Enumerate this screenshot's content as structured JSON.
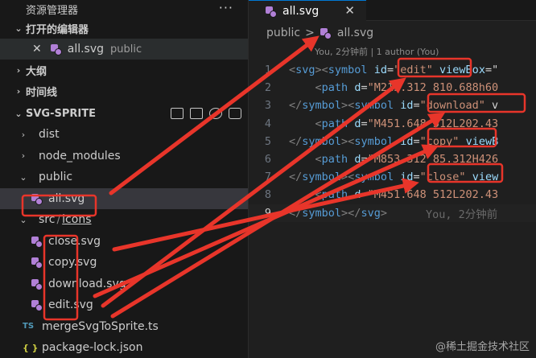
{
  "sidebar": {
    "header_title": "资源管理器",
    "header_more": "···",
    "open_editors": {
      "title": "打开的编辑器",
      "items": [
        {
          "close": "✕",
          "name": "all.svg",
          "path": "public"
        }
      ]
    },
    "outline_title": "大纲",
    "timeline_title": "时间线",
    "project": {
      "title": "SVG-SPRITE",
      "tree": [
        {
          "label": "dist",
          "kind": "folder",
          "open": false
        },
        {
          "label": "node_modules",
          "kind": "folder",
          "open": false
        },
        {
          "label": "public",
          "kind": "folder",
          "open": true
        },
        {
          "label": "all.svg",
          "kind": "svg",
          "depth": 1
        },
        {
          "label": "src",
          "label2": "icons",
          "kind": "folder",
          "open": true
        },
        {
          "label": "close.svg",
          "kind": "svg",
          "depth": 1
        },
        {
          "label": "copy.svg",
          "kind": "svg",
          "depth": 1
        },
        {
          "label": "download.svg",
          "kind": "svg",
          "depth": 1
        },
        {
          "label": "edit.svg",
          "kind": "svg",
          "depth": 1
        },
        {
          "label": "mergeSvgToSprite.ts",
          "kind": "ts",
          "badge": "TS"
        },
        {
          "label": "package-lock.json",
          "kind": "json",
          "badge": "{ }"
        }
      ]
    }
  },
  "editor": {
    "tab": {
      "name": "all.svg",
      "close": "✕"
    },
    "breadcrumb": {
      "folder": "public",
      "sep": ">",
      "file": "all.svg"
    },
    "blame": "You, 2分钟前 | 1 author (You)",
    "lines": [
      {
        "n": "1",
        "parts": [
          [
            "pn",
            "<"
          ],
          [
            "tg",
            "svg"
          ],
          [
            "pn",
            "><"
          ],
          [
            "tg",
            "symbol"
          ],
          [
            "cc",
            " "
          ],
          [
            "ar",
            "id"
          ],
          [
            "cc",
            "="
          ],
          [
            "st",
            "\"edit\""
          ],
          [
            "cc",
            " "
          ],
          [
            "ar",
            "viewBox"
          ],
          [
            "cc",
            "=\""
          ]
        ]
      },
      {
        "n": "2",
        "parts": [
          [
            "cc",
            "    "
          ],
          [
            "pn",
            "<"
          ],
          [
            "tg",
            "path"
          ],
          [
            "cc",
            " "
          ],
          [
            "ar",
            "d"
          ],
          [
            "cc",
            "="
          ],
          [
            "st",
            "\"M213.312 810.688h60"
          ]
        ]
      },
      {
        "n": "3",
        "parts": [
          [
            "pn",
            "</"
          ],
          [
            "tg",
            "symbol"
          ],
          [
            "pn",
            "><"
          ],
          [
            "tg",
            "symbol"
          ],
          [
            "cc",
            " "
          ],
          [
            "ar",
            "id"
          ],
          [
            "cc",
            "="
          ],
          [
            "st",
            "\"download\""
          ],
          [
            "cc",
            " v"
          ]
        ]
      },
      {
        "n": "4",
        "parts": [
          [
            "cc",
            "    "
          ],
          [
            "pn",
            "<"
          ],
          [
            "tg",
            "path"
          ],
          [
            "cc",
            " "
          ],
          [
            "ar",
            "d"
          ],
          [
            "cc",
            "="
          ],
          [
            "st",
            "\"M451.648 512L202.43"
          ]
        ]
      },
      {
        "n": "5",
        "parts": [
          [
            "pn",
            "</"
          ],
          [
            "tg",
            "symbol"
          ],
          [
            "pn",
            "><"
          ],
          [
            "tg",
            "symbol"
          ],
          [
            "cc",
            " "
          ],
          [
            "ar",
            "id"
          ],
          [
            "cc",
            "="
          ],
          [
            "st",
            "\"copy\""
          ],
          [
            "cc",
            " "
          ],
          [
            "ar",
            "viewB"
          ]
        ]
      },
      {
        "n": "6",
        "parts": [
          [
            "cc",
            "    "
          ],
          [
            "pn",
            "<"
          ],
          [
            "tg",
            "path"
          ],
          [
            "cc",
            " "
          ],
          [
            "ar",
            "d"
          ],
          [
            "cc",
            "="
          ],
          [
            "st",
            "\"M853.312 85.312H426"
          ]
        ]
      },
      {
        "n": "7",
        "parts": [
          [
            "pn",
            "</"
          ],
          [
            "tg",
            "symbol"
          ],
          [
            "pn",
            "><"
          ],
          [
            "tg",
            "symbol"
          ],
          [
            "cc",
            " "
          ],
          [
            "ar",
            "id"
          ],
          [
            "cc",
            "="
          ],
          [
            "st",
            "\"close\""
          ],
          [
            "cc",
            " "
          ],
          [
            "ar",
            "view"
          ]
        ]
      },
      {
        "n": "8",
        "parts": [
          [
            "cc",
            "    "
          ],
          [
            "pn",
            "<"
          ],
          [
            "tg",
            "path"
          ],
          [
            "cc",
            " "
          ],
          [
            "ar",
            "d"
          ],
          [
            "cc",
            "="
          ],
          [
            "st",
            "\"M451.648 512L202.43"
          ]
        ]
      },
      {
        "n": "9",
        "parts": [
          [
            "pn",
            "</"
          ],
          [
            "tg",
            "symbol"
          ],
          [
            "pn",
            "></"
          ],
          [
            "tg",
            "svg"
          ],
          [
            "pn",
            ">"
          ]
        ],
        "inline_blame": "You, 2分钟前"
      }
    ]
  },
  "watermark": "@稀土掘金技术社区",
  "colors": {
    "annotation": "#e8352a",
    "svg_icon": "#b180d7",
    "ts_badge": "#519aba",
    "json_badge": "#cbcb41"
  }
}
